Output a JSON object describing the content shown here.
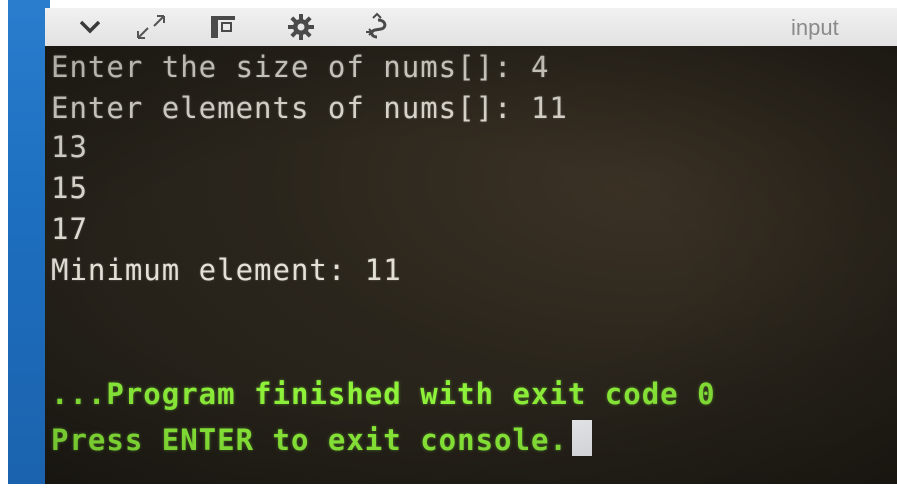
{
  "toolbar": {
    "icons": [
      "chevron-down-icon",
      "expand-icon",
      "layout-icon",
      "gear-icon",
      "debug-icon"
    ],
    "input_tab_label": "input"
  },
  "console": {
    "lines": [
      "Enter the size of nums[]: 4",
      "Enter elements of nums[]: 11",
      "13",
      "15",
      "17",
      "Minimum element: 11",
      "",
      "",
      "...Program finished with exit code 0",
      "Press ENTER to exit console."
    ]
  },
  "colors": {
    "console_text": "#e4e0d6",
    "status_text": "#8ef23a",
    "console_background": "#2a251c",
    "sidebar_blue": "#1d6fc0"
  }
}
